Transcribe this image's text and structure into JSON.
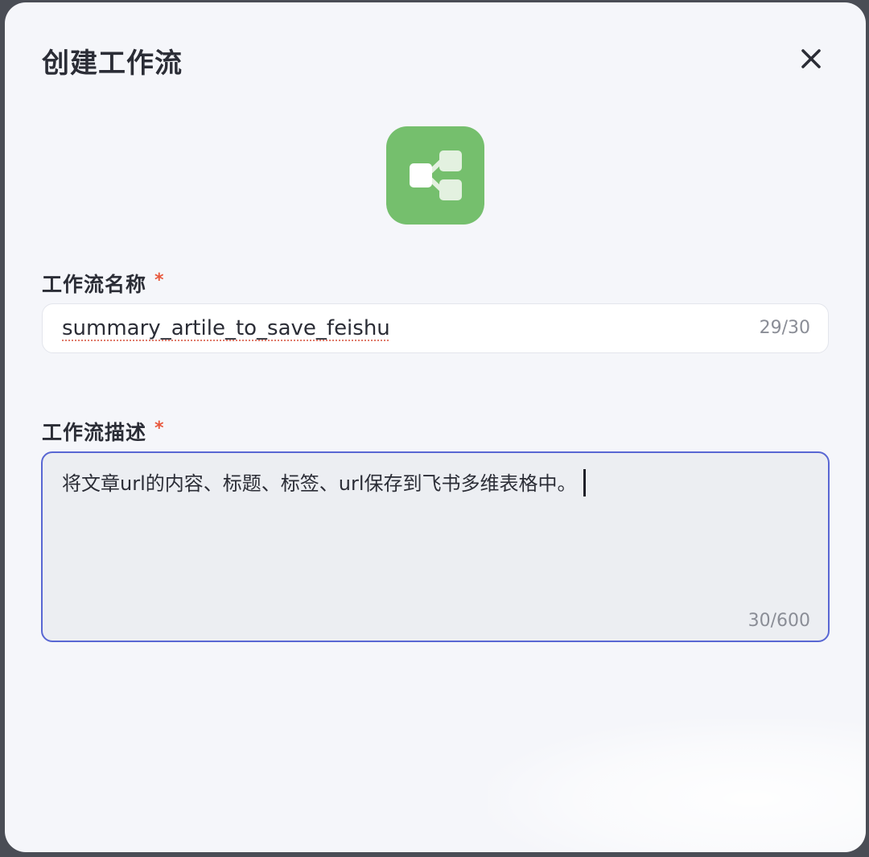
{
  "dialog": {
    "title": "创建工作流",
    "close_icon": "close-icon",
    "app_icon": "workflow-icon",
    "accent_color": "#75bf6d",
    "focus_color": "#5967d3"
  },
  "name_field": {
    "label": "工作流名称",
    "required_mark": "*",
    "value": "summary_artile_to_save_feishu",
    "counter": "29/30"
  },
  "description_field": {
    "label": "工作流描述",
    "required_mark": "*",
    "value": "将文章url的内容、标题、标签、url保存到飞书多维表格中。",
    "counter": "30/600"
  }
}
